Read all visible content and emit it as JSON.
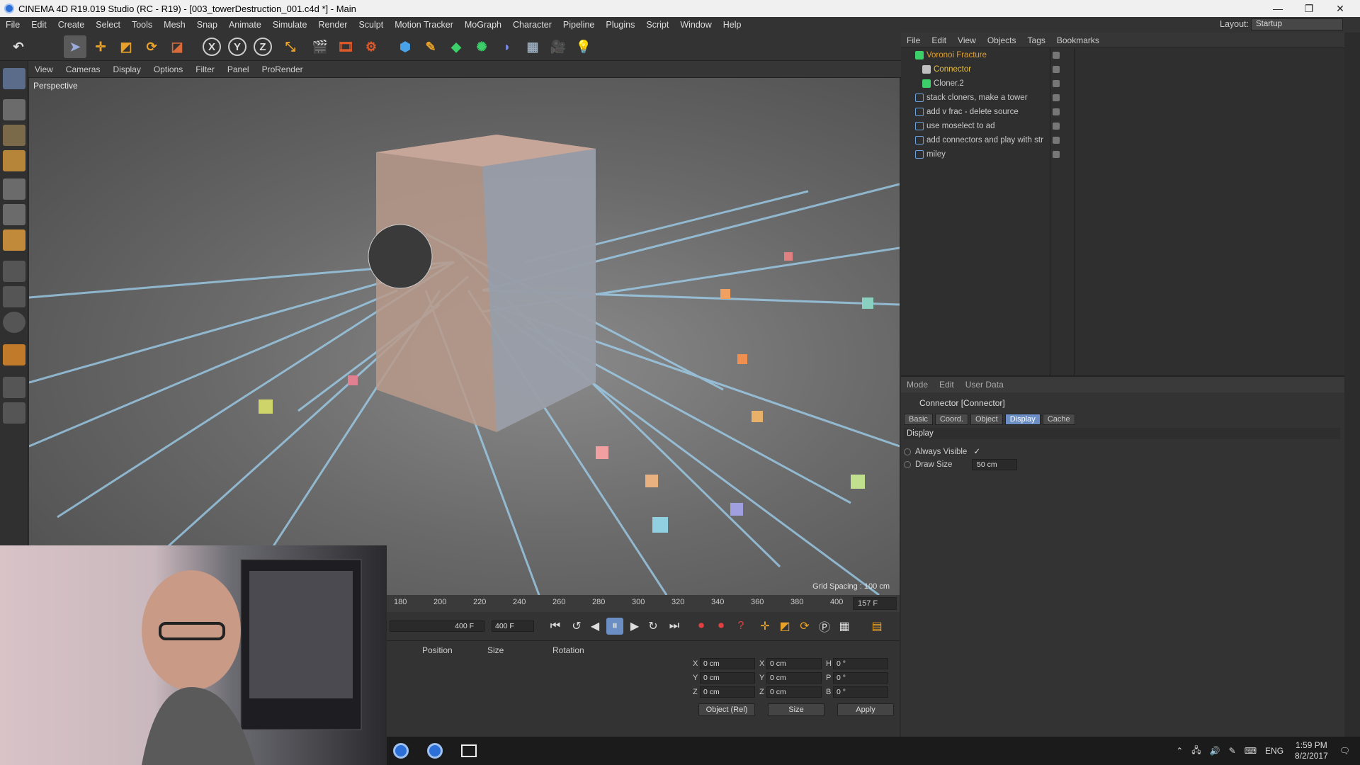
{
  "window": {
    "title": "CINEMA 4D R19.019 Studio (RC - R19) - [003_towerDestruction_001.c4d *] - Main"
  },
  "menu": [
    "File",
    "Edit",
    "Create",
    "Select",
    "Tools",
    "Mesh",
    "Snap",
    "Animate",
    "Simulate",
    "Render",
    "Sculpt",
    "Motion Tracker",
    "MoGraph",
    "Character",
    "Pipeline",
    "Plugins",
    "Script",
    "Window",
    "Help"
  ],
  "layout": {
    "label": "Layout:",
    "value": "Startup"
  },
  "axis": {
    "x": "X",
    "y": "Y",
    "z": "Z"
  },
  "viewport_menu": [
    "View",
    "Cameras",
    "Display",
    "Options",
    "Filter",
    "Panel",
    "ProRender"
  ],
  "viewport": {
    "label": "Perspective",
    "grid_spacing": "Grid Spacing : 100 cm"
  },
  "timeline": {
    "ticks": [
      "180",
      "200",
      "220",
      "240",
      "260",
      "280",
      "300",
      "320",
      "340",
      "360",
      "380",
      "400"
    ],
    "current_frame": "157 F"
  },
  "playback": {
    "start": "400 F",
    "end": "400 F"
  },
  "coords": {
    "headers": {
      "position": "Position",
      "size": "Size",
      "rotation": "Rotation"
    },
    "rows": [
      {
        "axis": "X",
        "pos": "0 cm",
        "size_axis": "X",
        "size": "0 cm",
        "rot_axis": "H",
        "rot": "0 °"
      },
      {
        "axis": "Y",
        "pos": "0 cm",
        "size_axis": "Y",
        "size": "0 cm",
        "rot_axis": "P",
        "rot": "0 °"
      },
      {
        "axis": "Z",
        "pos": "0 cm",
        "size_axis": "Z",
        "size": "0 cm",
        "rot_axis": "B",
        "rot": "0 °"
      }
    ],
    "mode": "Object (Rel)",
    "size_mode": "Size",
    "apply": "Apply"
  },
  "objects_menu": [
    "File",
    "Edit",
    "View",
    "Objects",
    "Tags",
    "Bookmarks"
  ],
  "objects": [
    {
      "name": "Voronoi Fracture",
      "color": "#e0a030",
      "indent": 0
    },
    {
      "name": "Connector",
      "color": "#e8c040",
      "indent": 1
    },
    {
      "name": "Cloner.2",
      "color": "#aaaaaa",
      "indent": 1
    },
    {
      "name": "stack cloners, make a tower",
      "color": "#aaaaaa",
      "indent": 0
    },
    {
      "name": "add v frac - delete source",
      "color": "#aaaaaa",
      "indent": 0
    },
    {
      "name": "use moselect to ad",
      "color": "#aaaaaa",
      "indent": 0
    },
    {
      "name": "add connectors and play with str",
      "color": "#aaaaaa",
      "indent": 0
    },
    {
      "name": "miley",
      "color": "#aaaaaa",
      "indent": 0
    }
  ],
  "attributes": {
    "menu": [
      "Mode",
      "Edit",
      "User Data"
    ],
    "title": "Connector [Connector]",
    "tabs": [
      "Basic",
      "Coord.",
      "Object",
      "Display",
      "Cache"
    ],
    "active_tab": "Display",
    "section": "Display",
    "params": [
      {
        "label": "Always Visible",
        "value": "✓"
      },
      {
        "label": "Draw Size",
        "value": "50 cm"
      }
    ]
  },
  "taskbar": {
    "lang": "ENG",
    "time": "1:59 PM",
    "date": "8/2/2017"
  }
}
